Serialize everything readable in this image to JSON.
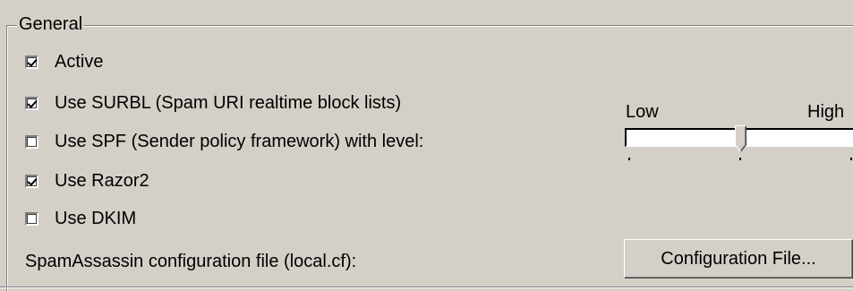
{
  "group": {
    "title": "General"
  },
  "options": [
    {
      "label": "Active",
      "checked": true
    },
    {
      "label": "Use SURBL (Spam URI realtime block lists)",
      "checked": true
    },
    {
      "label": "Use SPF (Sender policy framework) with level:",
      "checked": false
    },
    {
      "label": "Use Razor2",
      "checked": true
    },
    {
      "label": "Use DKIM",
      "checked": false
    }
  ],
  "spf_level": {
    "low_label": "Low",
    "high_label": "High",
    "value_fraction": 0.5,
    "tick_count": 3
  },
  "config": {
    "label": "SpamAssassin configuration file (local.cf):",
    "button_label": "Configuration File..."
  }
}
